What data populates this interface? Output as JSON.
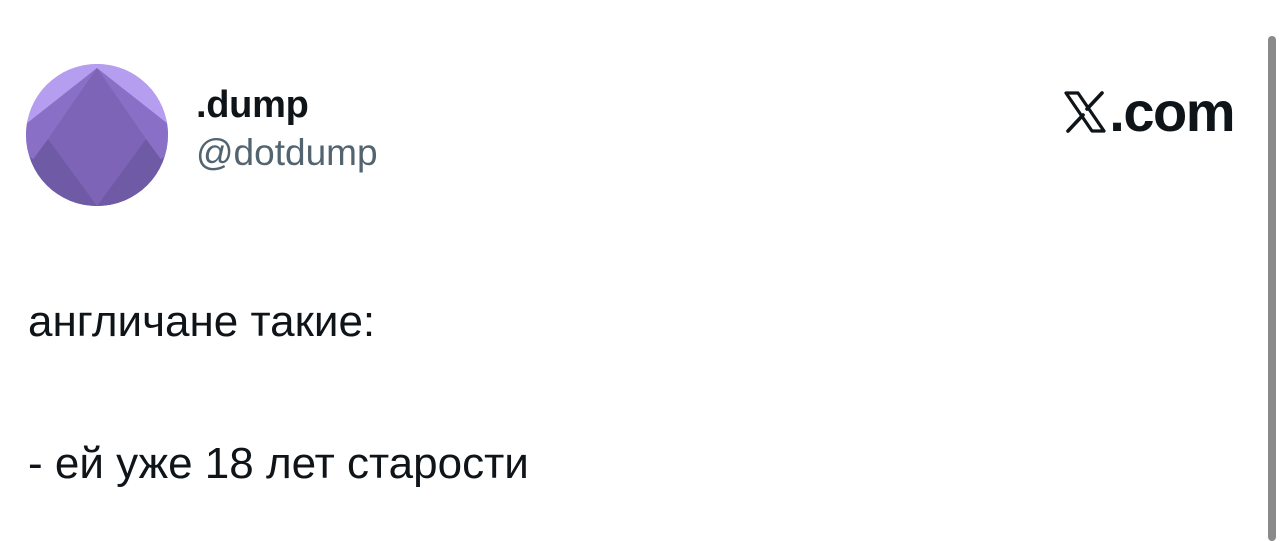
{
  "author": {
    "display_name": ".dump",
    "handle": "@dotdump",
    "avatar_icon": "purple-diamond-avatar"
  },
  "brand": {
    "logo_icon": "x-logo-icon",
    "text": ".com"
  },
  "tweet": {
    "line1": "англичане такие:",
    "line2": "- ей уже 18 лет старости"
  },
  "colors": {
    "text_primary": "#0f1419",
    "text_secondary": "#536471",
    "avatar_light": "#b39ae8",
    "avatar_mid": "#8a6fc4",
    "avatar_dark": "#6a559f"
  }
}
